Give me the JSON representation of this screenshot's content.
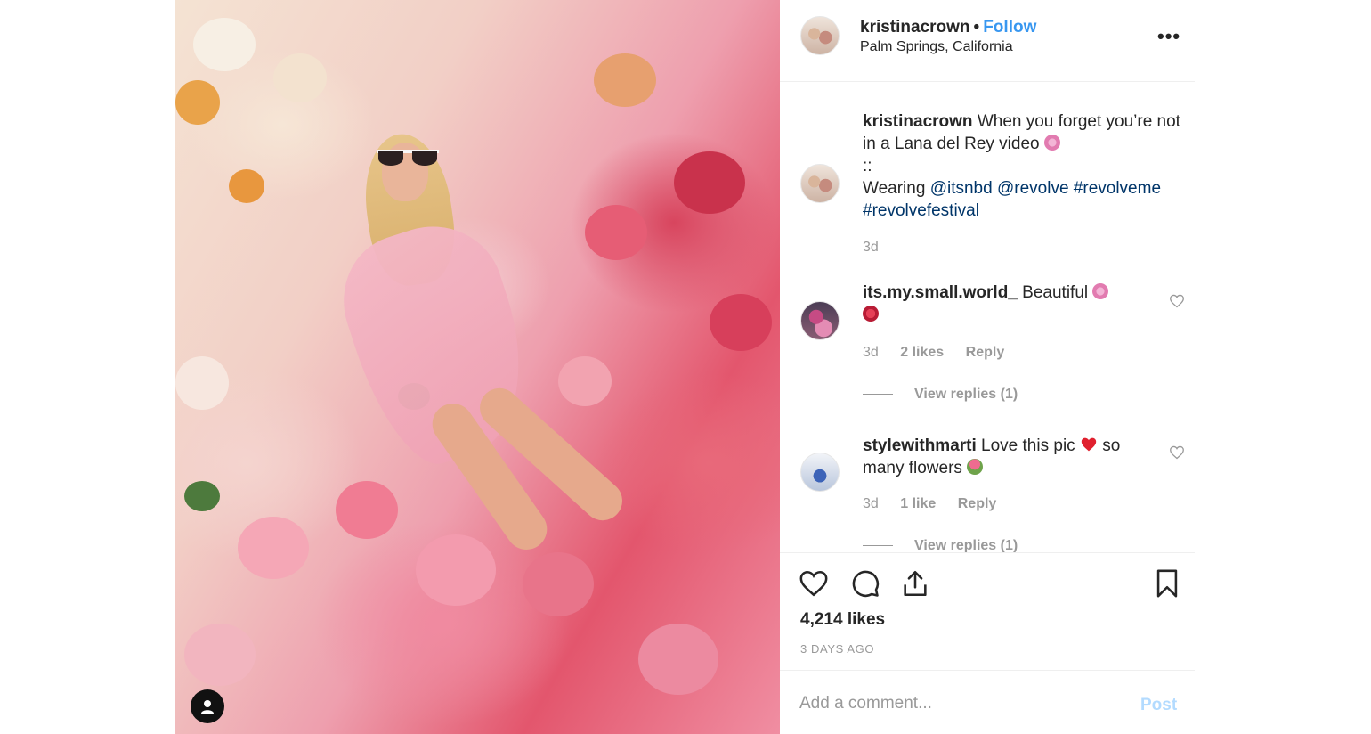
{
  "post": {
    "username": "kristinacrown",
    "separator": "•",
    "follow_label": "Follow",
    "location": "Palm Springs, California",
    "more_label": "•••"
  },
  "caption": {
    "username": "kristinacrown",
    "line1": "When you forget you’re not in a Lana del Rey video",
    "emoji1": "cherry-blossom",
    "divider": "::",
    "wearing_label": "Wearing",
    "mention1": "@itsnbd",
    "mention2": "@revolve",
    "hashtag1": "#revolveme",
    "hashtag2": "#revolvefestival",
    "time": "3d"
  },
  "comments": [
    {
      "username": "its.my.small.world_",
      "text": "Beautiful",
      "emojis": [
        "cherry-blossom",
        "rose"
      ],
      "time": "3d",
      "likes": "2 likes",
      "reply_label": "Reply",
      "view_replies": "View replies (1)"
    },
    {
      "username": "stylewithmarti",
      "text_before": "Love this pic",
      "text_after": "so many flowers",
      "emojis": [
        "red-heart",
        "tulip"
      ],
      "time": "3d",
      "likes": "1 like",
      "reply_label": "Reply",
      "view_replies": "View replies (1)"
    }
  ],
  "actions": {
    "likes": "4,214 likes",
    "posted_ago": "3 DAYS AGO"
  },
  "composer": {
    "placeholder": "Add a comment...",
    "post_label": "Post"
  },
  "colors": {
    "follow_blue": "#3897f0",
    "link_navy": "#003569",
    "muted_gray": "#999999",
    "post_disabled": "#b3dbff"
  }
}
